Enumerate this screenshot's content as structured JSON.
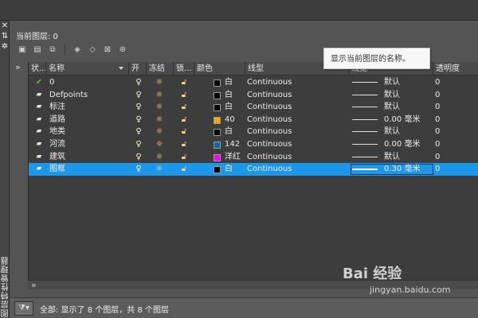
{
  "panel": {
    "current_layer_label": "当前图层: 0",
    "palette_vertical_title": "图层特性管理器"
  },
  "side_tools": [
    "close-icon",
    "pin-icon",
    "settings-icon"
  ],
  "toolbar": {
    "icons": [
      "new-property-filter-icon",
      "new-group-filter-icon",
      "layer-states-manager-icon",
      "new-layer-icon",
      "new-layer-vp-frozen-icon",
      "delete-layer-icon",
      "set-current-icon"
    ]
  },
  "columns": {
    "status": "状...",
    "name": "名称",
    "on": "开",
    "freeze": "冻结",
    "lock": "锁...",
    "color": "颜色",
    "linetype": "线型",
    "lineweight": "线宽",
    "transparency": "透明度"
  },
  "tooltip": "显示当前图层的名称。",
  "layers": [
    {
      "status": "current",
      "name": "0",
      "color_hex": "#000000",
      "color_name": "白",
      "linetype": "Continuous",
      "lineweight": "默认",
      "transparency": "0",
      "selected": false
    },
    {
      "status": "layer",
      "name": "Defpoints",
      "color_hex": "#000000",
      "color_name": "白",
      "linetype": "Continuous",
      "lineweight": "默认",
      "transparency": "0",
      "selected": false
    },
    {
      "status": "layer",
      "name": "标注",
      "color_hex": "#000000",
      "color_name": "白",
      "linetype": "Continuous",
      "lineweight": "默认",
      "transparency": "0",
      "selected": false
    },
    {
      "status": "layer",
      "name": "道路",
      "color_hex": "#ffa500",
      "color_name": "40",
      "linetype": "Continuous",
      "lineweight": "0.00 毫米",
      "transparency": "0",
      "selected": false
    },
    {
      "status": "layer",
      "name": "地类",
      "color_hex": "#000000",
      "color_name": "白",
      "linetype": "Continuous",
      "lineweight": "默认",
      "transparency": "0",
      "selected": false
    },
    {
      "status": "layer",
      "name": "河流",
      "color_hex": "#0b6c9e",
      "color_name": "142",
      "linetype": "Continuous",
      "lineweight": "0.00 毫米",
      "transparency": "0",
      "selected": false
    },
    {
      "status": "layer",
      "name": "建筑",
      "color_hex": "#ff00ff",
      "color_name": "洋红",
      "linetype": "Continuous",
      "lineweight": "默认",
      "transparency": "0",
      "selected": false
    },
    {
      "status": "layer",
      "name": "图框",
      "color_hex": "#000000",
      "color_name": "白",
      "linetype": "Continuous",
      "lineweight": "0.30 毫米",
      "transparency": "0",
      "selected": true
    }
  ],
  "status_bar": {
    "text": "全部: 显示了 8 个图层，共 8 个图层"
  },
  "watermark": {
    "brand": "Bai 经验",
    "url": "jingyan.baidu.com"
  }
}
